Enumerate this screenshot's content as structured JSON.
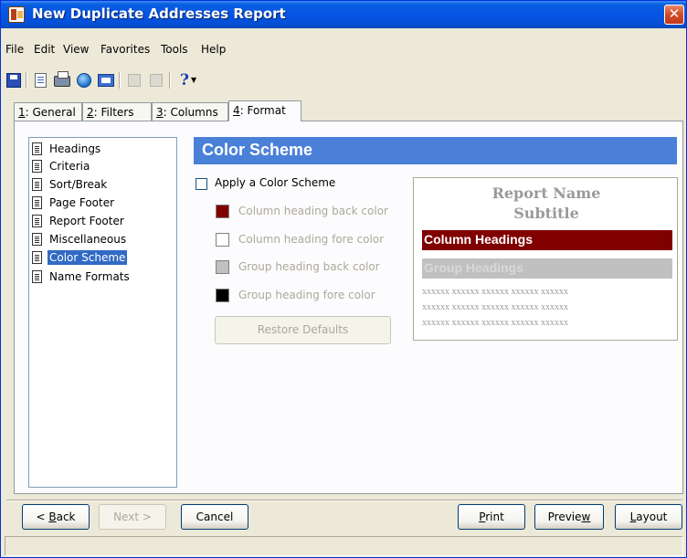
{
  "window": {
    "title": "New Duplicate Addresses Report",
    "close_glyph": "✕"
  },
  "menu": [
    "File",
    "Edit",
    "View",
    "Favorites",
    "Tools",
    "Help"
  ],
  "toolbar": {
    "icons": [
      "save-icon",
      "print-preview-icon",
      "print-icon",
      "web-icon",
      "export-icon",
      "disabled-icon",
      "properties-icon",
      "help-icon",
      "dropdown-arrow-icon"
    ],
    "help_glyph": "?",
    "dropdown_glyph": "▼"
  },
  "tabs": [
    {
      "key": "1",
      "label": ": General"
    },
    {
      "key": "2",
      "label": ": Filters"
    },
    {
      "key": "3",
      "label": ": Columns"
    },
    {
      "key": "4",
      "label": ": Format"
    }
  ],
  "tree": {
    "items": [
      "Headings",
      "Criteria",
      "Sort/Break",
      "Page Footer",
      "Report Footer",
      "Miscellaneous",
      "Color Scheme",
      "Name Formats"
    ],
    "selected": "Color Scheme"
  },
  "section_title": "Color Scheme",
  "color_options": {
    "apply_label": "Apply a Color Scheme",
    "apply_checked": false,
    "options": [
      {
        "label": "Column heading back color",
        "color": "#800000"
      },
      {
        "label": "Column heading fore color",
        "color": "#ffffff"
      },
      {
        "label": "Group heading back color",
        "color": "#c0c0c0"
      },
      {
        "label": "Group heading fore color",
        "color": "#000000"
      }
    ],
    "restore_label": "Restore Defaults"
  },
  "preview": {
    "report_name": "Report Name",
    "subtitle": "Subtitle",
    "column_headings": "Column Headings",
    "group_headings": "Group Headings",
    "detail_line": "xxxxxx xxxxxx xxxxxx xxxxxx xxxxxx",
    "column_heading_back": "#800000",
    "group_heading_back": "#c0c0c0"
  },
  "buttons": {
    "back_prefix": "< ",
    "back_mnemonic": "B",
    "back_rest": "ack",
    "next": "Next >",
    "cancel": "Cancel",
    "print_mnemonic": "P",
    "print_rest": "rint",
    "preview_pre": "Previe",
    "preview_mnemonic": "w",
    "layout_mnemonic": "L",
    "layout_rest": "ayout"
  },
  "status": ""
}
